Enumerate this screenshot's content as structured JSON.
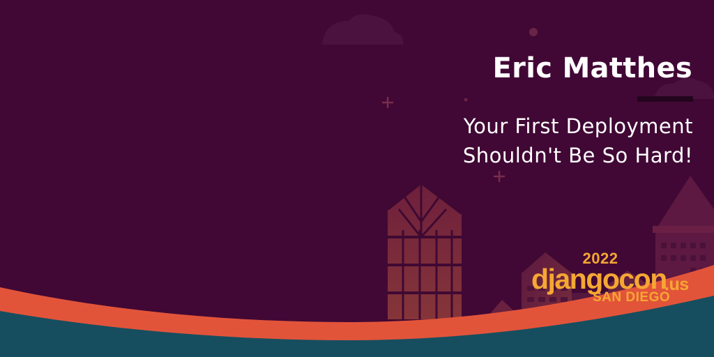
{
  "speaker": {
    "name": "Eric Matthes"
  },
  "talk": {
    "title_line1": "Your First Deployment",
    "title_line2": "Shouldn't Be So Hard!"
  },
  "logo": {
    "year": "2022",
    "wordmark": "djangocon",
    "tld": ".us",
    "city": "SAN DIEGO"
  },
  "colors": {
    "background": "#410835",
    "accent_orange": "#e2543a",
    "teal": "#164e5f",
    "logo_gold": "#f5a733",
    "text": "#ffffff"
  }
}
